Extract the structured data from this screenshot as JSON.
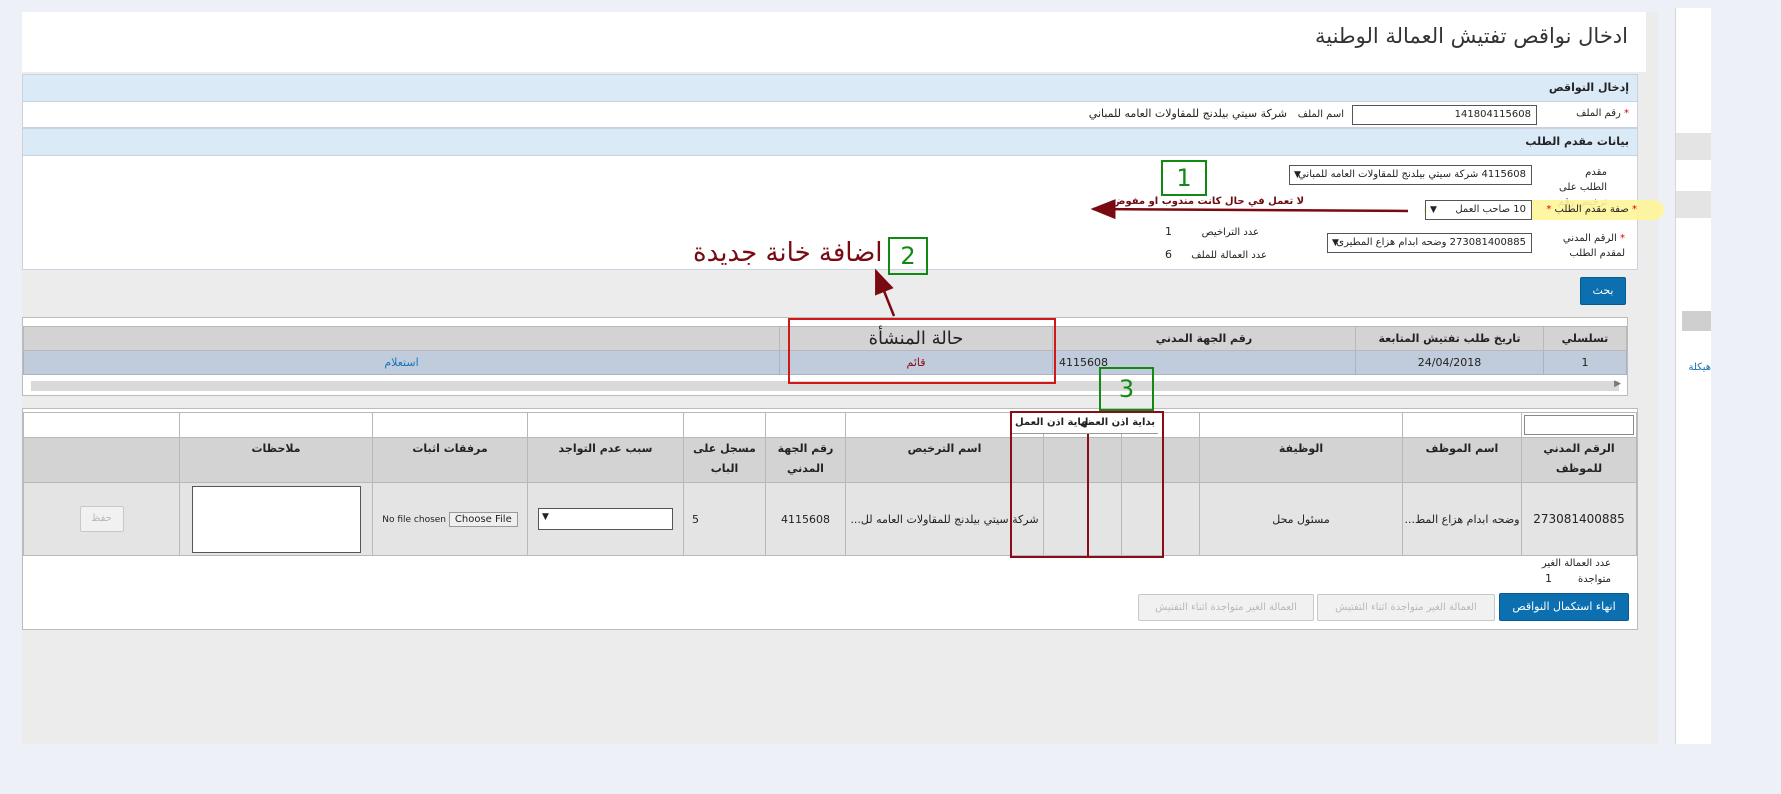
{
  "page": {
    "title": "ادخال نواقص تفتيش العمالة الوطنية"
  },
  "deficiencies": {
    "section_title": "إدخال النواقص",
    "file_no_label": "رقم الملف",
    "file_no_value": "141804115608",
    "file_name_label": "اسم الملف",
    "file_name_value": "شركة سيتي بيلدنج للمقاولات العامه للمباني"
  },
  "applicant": {
    "section_title": "بيانات مقدم الطلب",
    "license_label": "مقدم الطلب على ترخيص رقم",
    "license_value": "4115608 شركة سيتي بيلدنج للمقاولات العامه للمباني",
    "capacity_label": "صفة مقدم الطلب",
    "capacity_value": "10 صاحب العمل",
    "civil_id_label": "الرقم المدني لمقدم الطلب",
    "civil_id_value": "273081400885 وضحه ابدام هزاع المطيرى",
    "licenses_count_label": "عدد التراخيص",
    "licenses_count_value": "1",
    "workers_count_label": "عدد العمالة للملف",
    "workers_count_value": "6"
  },
  "search_button": "بحث",
  "requests_table": {
    "headers": [
      "تسلسلي",
      "تاريخ طلب تفتيش المتابعة",
      "رقم الجهة المدني",
      "حالة المنشأة",
      ""
    ],
    "rows": [
      {
        "serial": "1",
        "date": "24/04/2018",
        "civil_no": "4115608",
        "status": "قائم",
        "action": "استعلام"
      }
    ]
  },
  "workers_table": {
    "headers": [
      "الرقم المدني للموظف",
      "اسم الموظف",
      "الوظيفة",
      "بداية اذن العمل",
      "نهاية اذن العمل",
      "اسم الترخيص",
      "رقم الجهة المدني",
      "مسجل على الباب",
      "سبب عدم التواجد",
      "مرفقات اثبات",
      "ملاحظات",
      ""
    ],
    "rows": [
      {
        "civil_id": "273081400885",
        "name": "وضحه ابدام هزاع المط...",
        "job": "مسئول محل",
        "license_name": "شركة سيتي بيلدنج للمقاولات العامه لل...",
        "entity_no": "4115608",
        "registered": "5",
        "reason": "",
        "file_button": "Choose File",
        "file_status": "No file chosen",
        "notes": "",
        "save": "حفظ"
      }
    ]
  },
  "absent_count_label": "عدد العمالة الغير متواجدة",
  "absent_count_value": "1",
  "bottom_buttons": {
    "finish": "انهاء استكمال النواقص",
    "absent_workers": "العمالة الغير متواجدة اثناء التفتيش",
    "absent_workers_2": "العمالة الغير متواجدة اثناء التفتيش"
  },
  "annotations": {
    "n1": "1",
    "n2": "2",
    "n3": "3",
    "note_capacity": "لا تعمل في حال كانت مندوب او مفوض",
    "add_new_field": "اضافة خانة جديدة"
  },
  "right_panel": {
    "link": "هيكلة"
  },
  "colors": {
    "accent": "#0b6fb0",
    "annotation_red": "#d01818",
    "annotation_dark_red": "#8a0c16",
    "annotation_green": "#128a12",
    "highlight": "#fff59a"
  }
}
